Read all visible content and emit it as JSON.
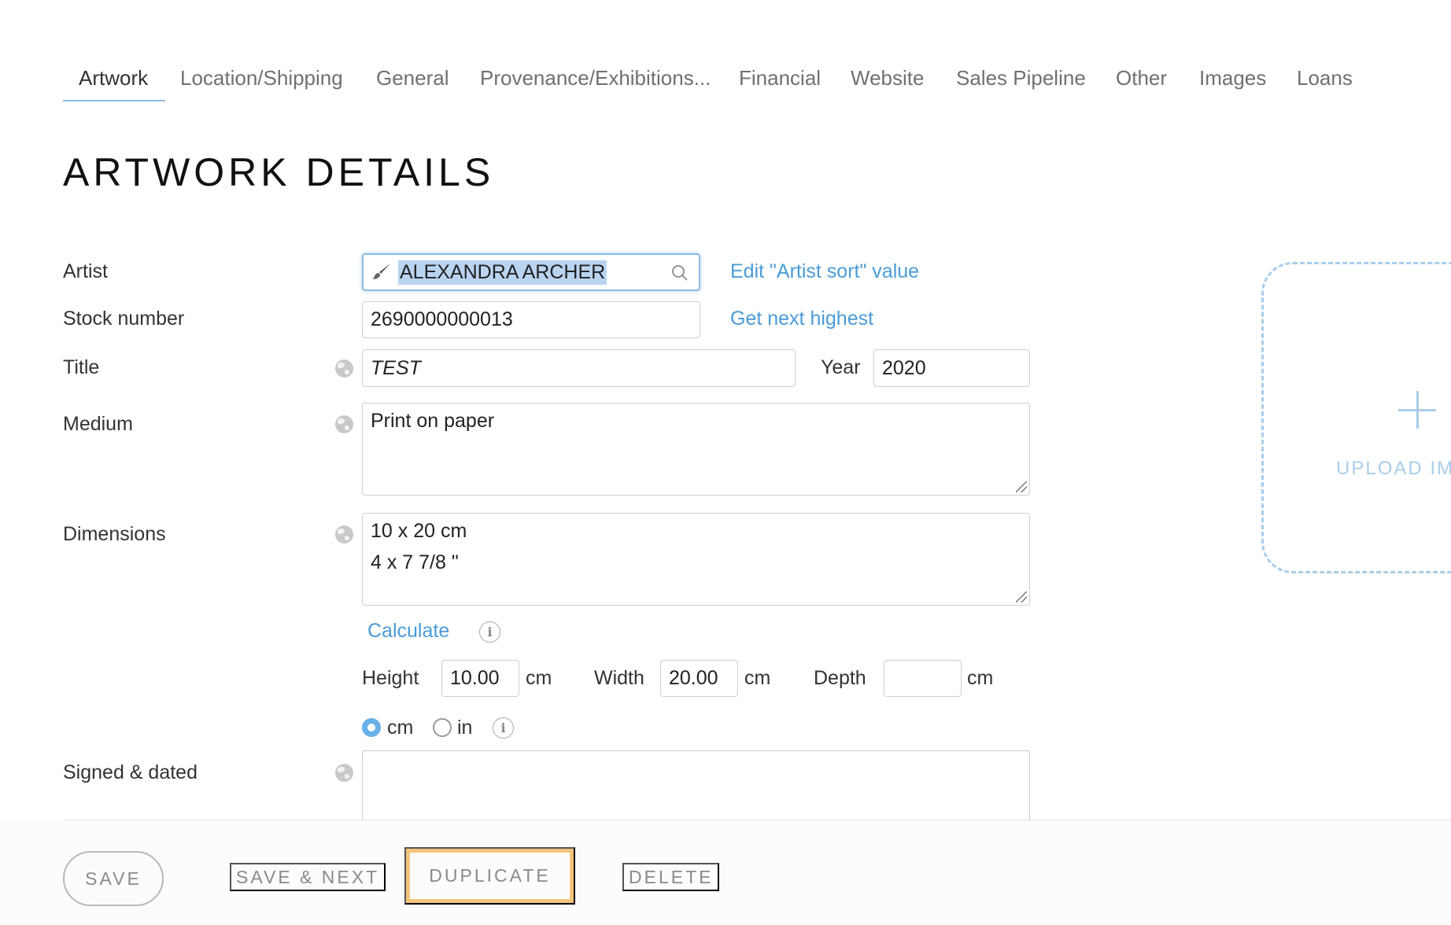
{
  "tabs": [
    {
      "label": "Artwork",
      "active": true
    },
    {
      "label": "Location/Shipping"
    },
    {
      "label": "General"
    },
    {
      "label": "Provenance/Exhibitions..."
    },
    {
      "label": "Financial"
    },
    {
      "label": "Website"
    },
    {
      "label": "Sales Pipeline"
    },
    {
      "label": "Other"
    },
    {
      "label": "Images"
    },
    {
      "label": "Loans"
    }
  ],
  "page_title": "ARTWORK DETAILS",
  "form": {
    "artist": {
      "label": "Artist",
      "value": "ALEXANDRA ARCHER",
      "link": "Edit \"Artist sort\" value",
      "icon": "brush-icon"
    },
    "stock_number": {
      "label": "Stock number",
      "value": "2690000000013",
      "link": "Get next highest"
    },
    "title": {
      "label": "Title",
      "value": "TEST"
    },
    "year": {
      "label": "Year",
      "value": "2020"
    },
    "medium": {
      "label": "Medium",
      "value": "Print on paper"
    },
    "dimensions": {
      "label": "Dimensions",
      "line1": "10 x 20 cm",
      "line2": "4 x 7 7/8 \""
    },
    "calculate_link": "Calculate",
    "height": {
      "label": "Height",
      "value": "10.00",
      "unit": "cm"
    },
    "width": {
      "label": "Width",
      "value": "20.00",
      "unit": "cm"
    },
    "depth": {
      "label": "Depth",
      "value": "",
      "unit": "cm"
    },
    "unit_options": [
      {
        "label": "cm",
        "selected": true
      },
      {
        "label": "in",
        "selected": false
      }
    ],
    "signed_dated": {
      "label": "Signed & dated",
      "value": ""
    }
  },
  "upload": {
    "label": "UPLOAD IM"
  },
  "footer": {
    "save": "SAVE",
    "save_next": "SAVE & NEXT",
    "duplicate": "DUPLICATE",
    "delete": "DELETE"
  },
  "colors": {
    "link": "#4a9bd8",
    "highlight": "#f3c47c",
    "upload": "#a9cde9"
  }
}
